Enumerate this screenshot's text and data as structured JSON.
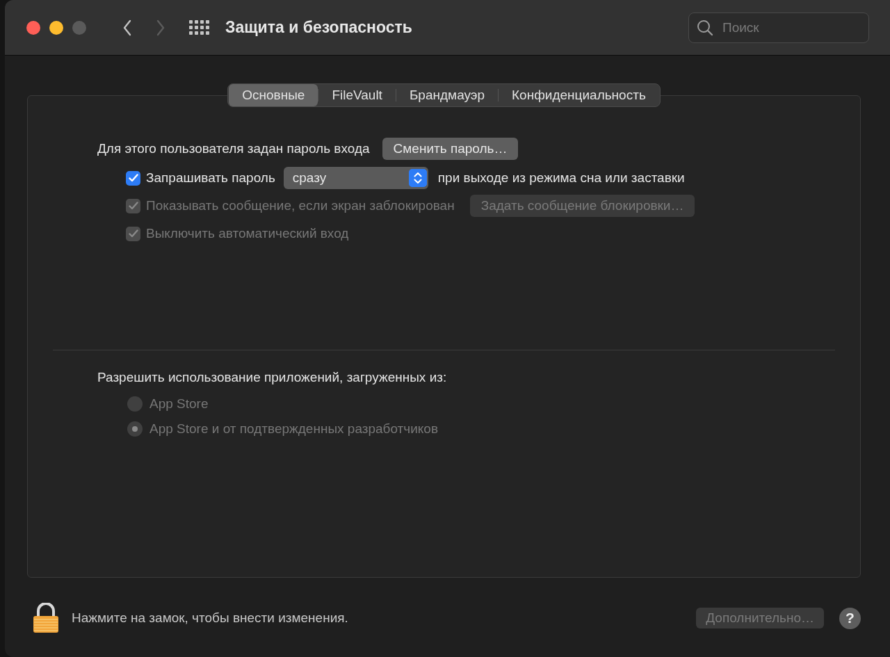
{
  "window": {
    "title": "Защита и безопасность"
  },
  "toolbar": {
    "back": {
      "disabled": false
    },
    "forward": {
      "disabled": true
    },
    "search": {
      "placeholder": "Поиск"
    }
  },
  "tabs": [
    {
      "label": "Основные",
      "selected": true
    },
    {
      "label": "FileVault",
      "selected": false
    },
    {
      "label": "Брандмауэр",
      "selected": false
    },
    {
      "label": "Конфиденциальность",
      "selected": false
    }
  ],
  "general": {
    "password_label": "Для этого пользователя задан пароль входа",
    "change_button": {
      "label": "Сменить пароль…",
      "disabled": false
    },
    "options": [
      {
        "kind": "checkbox-select",
        "label": "Запрашивать пароль",
        "checked": true,
        "disabled": false,
        "select_value": "сразу",
        "suffix": "при выходе из режима сна или заставки"
      },
      {
        "kind": "checkbox-button",
        "label": "Показывать сообщение, если экран заблокирован",
        "checked": true,
        "disabled": true,
        "button": "Задать сообщение блокировки…"
      },
      {
        "kind": "checkbox",
        "label": "Выключить автоматический вход",
        "checked": true,
        "disabled": true
      }
    ]
  },
  "apps": {
    "heading": "Разрешить использование приложений, загруженных из:",
    "options": [
      {
        "label": "App Store",
        "selected": false,
        "disabled": true
      },
      {
        "label": "App Store и от подтвержденных разработчиков",
        "selected": true,
        "disabled": true
      }
    ]
  },
  "footer": {
    "lock_text": "Нажмите на замок, чтобы внести изменения.",
    "advanced_button": {
      "label": "Дополнительно…",
      "disabled": true
    },
    "help": "?"
  }
}
